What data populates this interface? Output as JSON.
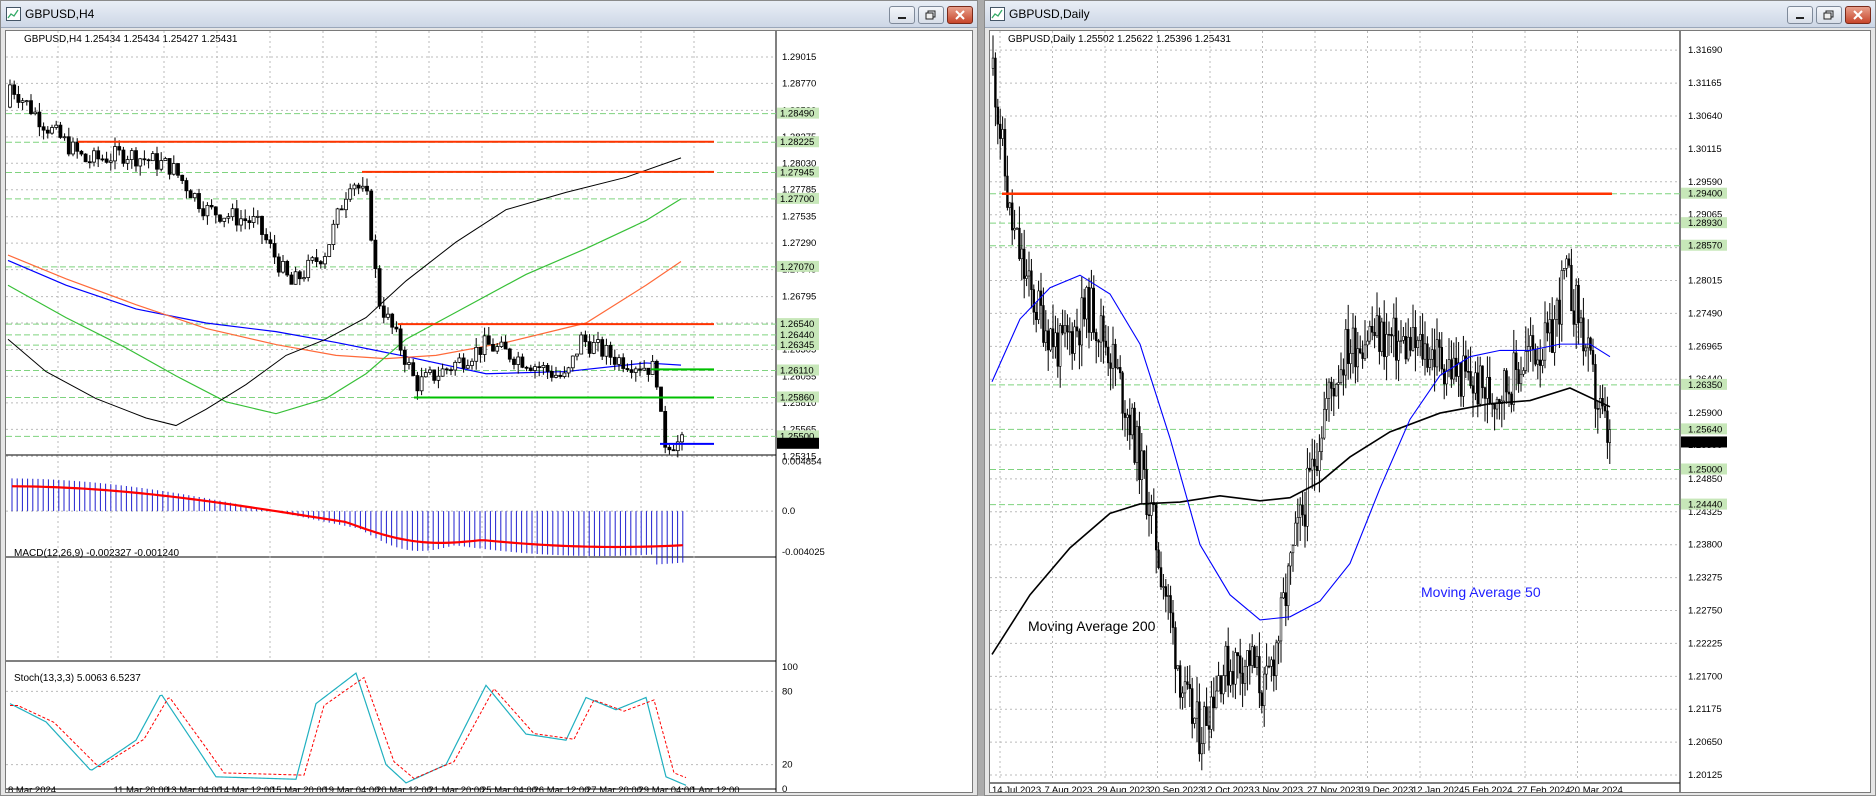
{
  "left": {
    "title": "GBPUSD,H4",
    "info": "GBPUSD,H4  1.25434 1.25434 1.25427 1.25431",
    "price_axis": [
      "1.29015",
      "1.28770",
      "1.28520",
      "1.28275",
      "1.28030",
      "1.27785",
      "1.27535",
      "1.27290",
      "1.27045",
      "1.26795",
      "1.26550",
      "1.26305",
      "1.26055",
      "1.25810",
      "1.25565",
      "1.25315"
    ],
    "level_tags": [
      {
        "v": "1.28490",
        "c": "#c7e7b9"
      },
      {
        "v": "1.28225",
        "c": "#c7e7b9"
      },
      {
        "v": "1.27945",
        "c": "#c7e7b9"
      },
      {
        "v": "1.27700",
        "c": "#c7e7b9"
      },
      {
        "v": "1.27070",
        "c": "#c7e7b9"
      },
      {
        "v": "1.26540",
        "c": "#c7e7b9"
      },
      {
        "v": "1.26440",
        "c": "#c7e7b9"
      },
      {
        "v": "1.26345",
        "c": "#c7e7b9"
      },
      {
        "v": "1.26110",
        "c": "#c7e7b9"
      },
      {
        "v": "1.25860",
        "c": "#c7e7b9"
      },
      {
        "v": "1.25500",
        "c": "#c7e7b9"
      },
      {
        "v": "1.25431",
        "c": "#000000"
      }
    ],
    "time_axis": [
      "8 Mar 2024",
      "11 Mar 20:00",
      "13 Mar 04:00",
      "14 Mar 12:00",
      "15 Mar 20:00",
      "19 Mar 04:00",
      "20 Mar 12:00",
      "21 Mar 20:00",
      "25 Mar 04:00",
      "26 Mar 12:00",
      "27 Mar 20:00",
      "29 Mar 04:00",
      "1 Apr 12:00"
    ],
    "macd_info": "MACD(12,26,9) -0.002327 -0.001240",
    "macd_axis": [
      "0.004854",
      "0.0",
      "-0.004025"
    ],
    "stoch_info": "Stoch(13,3,3) 5.0063 6.5237",
    "stoch_axis": [
      "100",
      "80",
      "20",
      "0"
    ]
  },
  "right": {
    "title": "GBPUSD,Daily",
    "info": "GBPUSD,Daily  1.25502 1.25622 1.25396 1.25431",
    "price_axis": [
      "1.31690",
      "1.31165",
      "1.30640",
      "1.30115",
      "1.29590",
      "1.29065",
      "1.28540",
      "1.28015",
      "1.27490",
      "1.26965",
      "1.26440",
      "1.25900",
      "1.25390",
      "1.24850",
      "1.24325",
      "1.23800",
      "1.23275",
      "1.22750",
      "1.22225",
      "1.21700",
      "1.21175",
      "1.20650",
      "1.20125"
    ],
    "level_tags": [
      {
        "v": "1.29400",
        "c": "#c7e7b9"
      },
      {
        "v": "1.28930",
        "c": "#c7e7b9"
      },
      {
        "v": "1.28570",
        "c": "#c7e7b9"
      },
      {
        "v": "1.26350",
        "c": "#c7e7b9"
      },
      {
        "v": "1.25640",
        "c": "#c7e7b9"
      },
      {
        "v": "1.25431",
        "c": "#000000"
      },
      {
        "v": "1.25000",
        "c": "#c7e7b9"
      },
      {
        "v": "1.24440",
        "c": "#c7e7b9"
      }
    ],
    "time_axis": [
      "14 Jul 2023",
      "7 Aug 2023",
      "29 Aug 2023",
      "20 Sep 2023",
      "12 Oct 2023",
      "3 Nov 2023",
      "27 Nov 2023",
      "19 Dec 2023",
      "12 Jan 2024",
      "5 Feb 2024",
      "27 Feb 2024",
      "20 Mar 2024"
    ],
    "ma200_label": "Moving Average 200",
    "ma50_label": "Moving Average 50"
  },
  "colors": {
    "resistance": "#ff3300",
    "support": "#00c000",
    "ma_blue": "#0000ff",
    "macd_hist": "#2020d0",
    "macd_signal": "#ff0000",
    "stoch_main": "#20b0c0"
  }
}
